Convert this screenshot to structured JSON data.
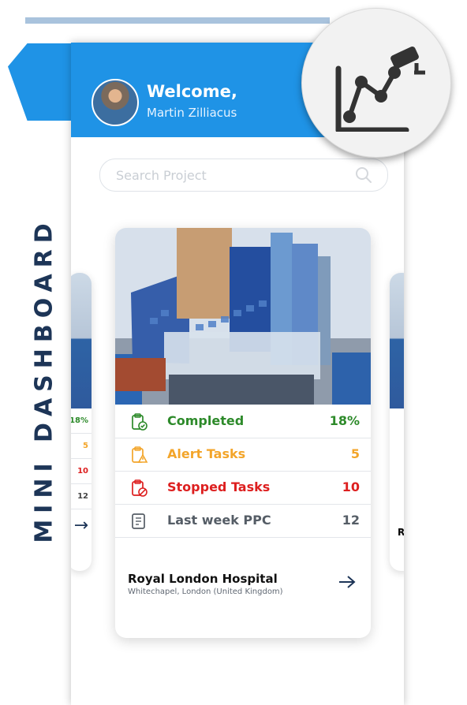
{
  "app": {
    "side_label": "MINI DASHBOARD",
    "feature_icon": "analytics-camera-icon",
    "accent": "#1f93e6"
  },
  "header": {
    "welcome": "Welcome,",
    "user_name": "Martin Zilliacus"
  },
  "search": {
    "placeholder": "Search Project",
    "icon": "search-icon"
  },
  "project": {
    "name": "Royal London Hospital",
    "location": "Whitechapel, London (United Kingdom)",
    "open_icon": "arrow-right-icon",
    "tasks": [
      {
        "label": "Completed",
        "value": "18%",
        "color": "#2d8a2a",
        "icon": "completed-clipboard-icon"
      },
      {
        "label": "Alert Tasks",
        "value": "5",
        "color": "#f3a52a",
        "icon": "alert-clipboard-icon"
      },
      {
        "label": "Stopped Tasks",
        "value": "10",
        "color": "#dd1f1f",
        "icon": "stopped-clipboard-icon"
      },
      {
        "label": "Last week PPC",
        "value": "12",
        "color": "#555d66",
        "icon": "document-list-icon"
      }
    ]
  },
  "carousel_side": {
    "left_values": [
      "18%",
      "5",
      "10",
      "12"
    ],
    "left_arrow": "→",
    "right_prefix": "R"
  }
}
